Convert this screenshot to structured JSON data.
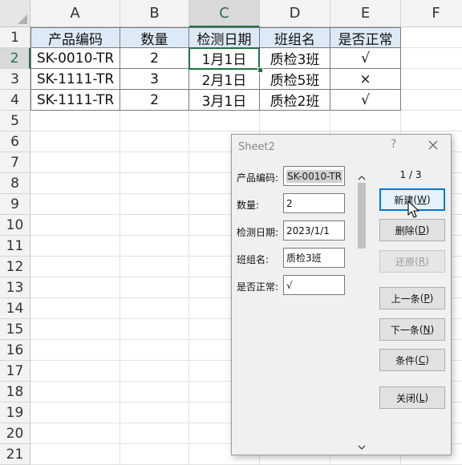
{
  "columns": [
    "A",
    "B",
    "C",
    "D",
    "E",
    "F"
  ],
  "rows": [
    "1",
    "2",
    "3",
    "4",
    "5",
    "6",
    "7",
    "8",
    "9",
    "10",
    "11",
    "12",
    "13",
    "14",
    "15",
    "16",
    "17",
    "18",
    "19",
    "20",
    "21"
  ],
  "selected": {
    "column": "C",
    "row": "2"
  },
  "table": {
    "headers": [
      "产品编码",
      "数量",
      "检测日期",
      "班组名",
      "是否正常"
    ],
    "rows": [
      [
        "SK-0010-TR",
        "2",
        "1月1日",
        "质检3班",
        "√"
      ],
      [
        "SK-1111-TR",
        "3",
        "2月1日",
        "质检5班",
        "×"
      ],
      [
        "SK-1111-TR",
        "2",
        "3月1日",
        "质检2班",
        "√"
      ]
    ]
  },
  "colors": {
    "header_fill": "#dce9f6",
    "accent": "#217346",
    "default_button": "#0078d7"
  },
  "dialog": {
    "title": "Sheet2",
    "help": "?",
    "counter": "1 / 3",
    "fields": [
      {
        "label": "产品编码:",
        "value": "SK-0010-TR"
      },
      {
        "label": "数量:",
        "value": "2"
      },
      {
        "label": "检测日期:",
        "value": "2023/1/1"
      },
      {
        "label": "班组名:",
        "value": "质检3班"
      },
      {
        "label": "是否正常:",
        "value": "√"
      }
    ],
    "buttons": {
      "new": {
        "text": "新建",
        "key": "W"
      },
      "delete": {
        "text": "删除",
        "key": "D"
      },
      "restore": {
        "text": "还原",
        "key": "R"
      },
      "prev": {
        "text": "上一条",
        "key": "P"
      },
      "next": {
        "text": "下一条",
        "key": "N"
      },
      "criteria": {
        "text": "条件",
        "key": "C"
      },
      "close": {
        "text": "关闭",
        "key": "L"
      }
    }
  }
}
